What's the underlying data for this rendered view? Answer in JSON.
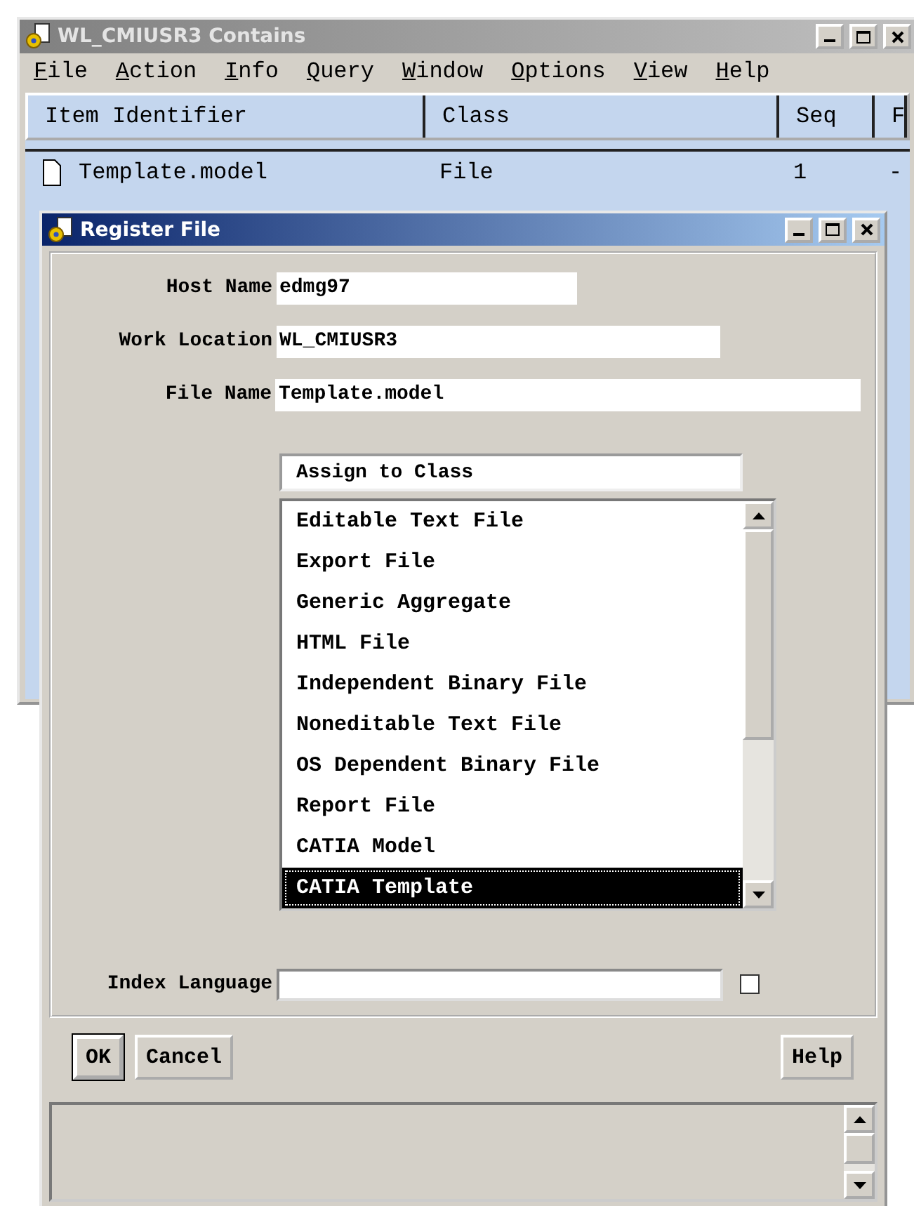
{
  "main_window": {
    "title": "WL_CMIUSR3 Contains",
    "active": false,
    "menu": [
      {
        "label": "File"
      },
      {
        "label": "Action"
      },
      {
        "label": "Info"
      },
      {
        "label": "Query"
      },
      {
        "label": "Window"
      },
      {
        "label": "Options"
      },
      {
        "label": "View"
      },
      {
        "label": "Help"
      }
    ],
    "table": {
      "columns": [
        "Item Identifier",
        "Class",
        "Seq",
        "F"
      ],
      "rows": [
        {
          "cells": [
            "Template.model",
            "File",
            "1",
            "-"
          ]
        }
      ]
    }
  },
  "dialog": {
    "title": "Register File",
    "active": true,
    "fields": [
      {
        "label": "Host Name",
        "value": "edmg97"
      },
      {
        "label": "Work Location",
        "value": "WL_CMIUSR3"
      },
      {
        "label": "File Name",
        "value": "Template.model"
      }
    ],
    "class_list": {
      "heading": "Assign to Class",
      "items": [
        {
          "label": "Editable Text File",
          "selected": false
        },
        {
          "label": "Export File",
          "selected": false
        },
        {
          "label": "Generic Aggregate",
          "selected": false
        },
        {
          "label": "HTML File",
          "selected": false
        },
        {
          "label": "Independent Binary File",
          "selected": false
        },
        {
          "label": "Noneditable Text File",
          "selected": false
        },
        {
          "label": "OS Dependent Binary File",
          "selected": false
        },
        {
          "label": "Report File",
          "selected": false
        },
        {
          "label": "CATIA Model",
          "selected": false
        },
        {
          "label": "CATIA Template",
          "selected": true
        }
      ]
    },
    "index_language": {
      "label": "Index Language",
      "checked": false
    },
    "buttons": [
      {
        "label": "OK",
        "default": true
      },
      {
        "label": "Cancel",
        "default": false
      },
      {
        "label": "Help",
        "default": false
      }
    ]
  }
}
